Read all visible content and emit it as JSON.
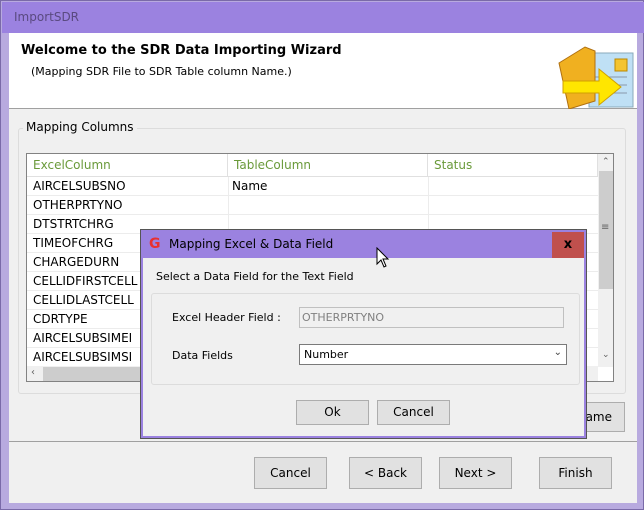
{
  "window": {
    "title": "ImportSDR"
  },
  "header": {
    "title": "Welcome to the SDR Data Importing Wizard",
    "subtitle": "(Mapping SDR File to SDR Table column Name.)",
    "icon": "folder-import-arrow-icon"
  },
  "group": {
    "label": "Mapping Columns"
  },
  "grid": {
    "columns": [
      "ExcelColumn",
      "TableColumn",
      "Status"
    ],
    "rows": [
      {
        "excel": "AIRCELSUBSNO",
        "table": "Name",
        "status": ""
      },
      {
        "excel": "OTHERPRTYNO",
        "table": "",
        "status": ""
      },
      {
        "excel": "DTSTRTCHRG",
        "table": "",
        "status": ""
      },
      {
        "excel": "TIMEOFCHRG",
        "table": "",
        "status": ""
      },
      {
        "excel": "CHARGEDURN",
        "table": "",
        "status": ""
      },
      {
        "excel": "CELLIDFIRSTCELL",
        "table": "",
        "status": ""
      },
      {
        "excel": "CELLIDLASTCELL",
        "table": "",
        "status": ""
      },
      {
        "excel": "CDRTYPE",
        "table": "",
        "status": ""
      },
      {
        "excel": "AIRCELSUBSIMEI",
        "table": "",
        "status": ""
      },
      {
        "excel": "AIRCELSUBSIMSI",
        "table": "",
        "status": ""
      }
    ]
  },
  "partial_button": {
    "label": "ame"
  },
  "footer": {
    "cancel": "Cancel",
    "back": "< Back",
    "next": "Next >",
    "finish": "Finish"
  },
  "dialog": {
    "title": "Mapping Excel & Data Field",
    "close": "x",
    "prompt": "Select a Data Field for the Text Field",
    "header_field_label": "Excel Header Field :",
    "header_field_value": "OTHERPRTYNO",
    "data_fields_label": "Data Fields",
    "data_fields_value": "Number",
    "ok": "Ok",
    "cancel": "Cancel"
  },
  "colors": {
    "titlebar": "#9b82e0",
    "close": "#c0504d",
    "header_text": "#6a9a3a"
  }
}
